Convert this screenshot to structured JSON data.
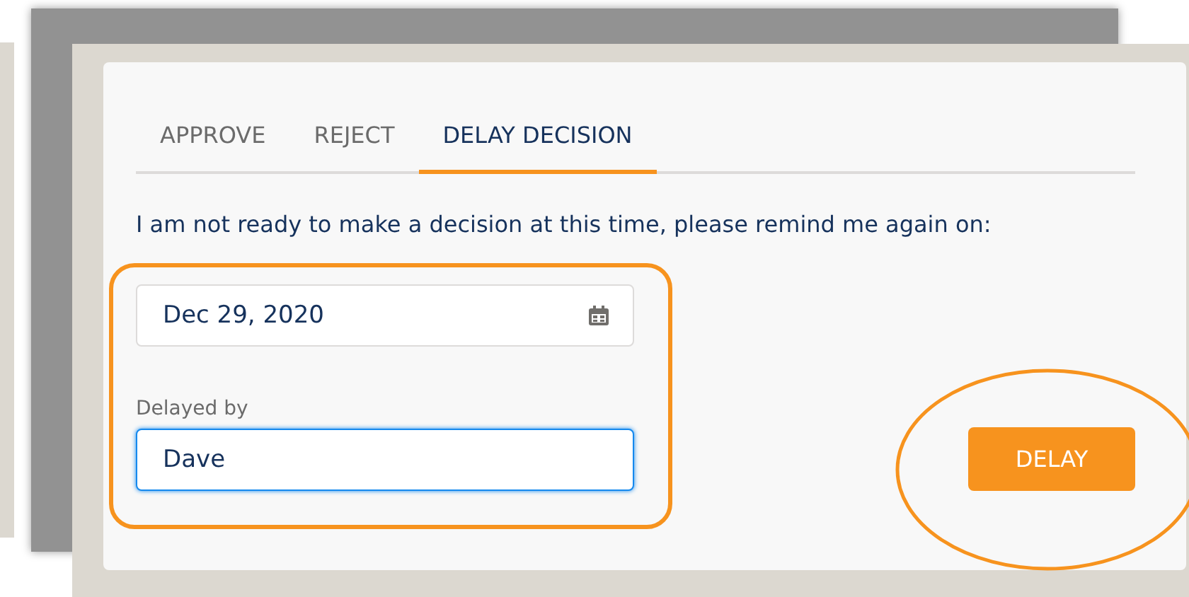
{
  "tabs": [
    {
      "label": "APPROVE",
      "selected": false
    },
    {
      "label": "REJECT",
      "selected": false
    },
    {
      "label": "DELAY DECISION",
      "selected": true
    }
  ],
  "message": "I am not ready to make a decision at this time, please remind me again on:",
  "date_field": {
    "value": "Dec 29, 2020"
  },
  "delayed_by": {
    "label": "Delayed by",
    "value": "Dave",
    "focused": true
  },
  "button": {
    "label": "DELAY"
  }
}
